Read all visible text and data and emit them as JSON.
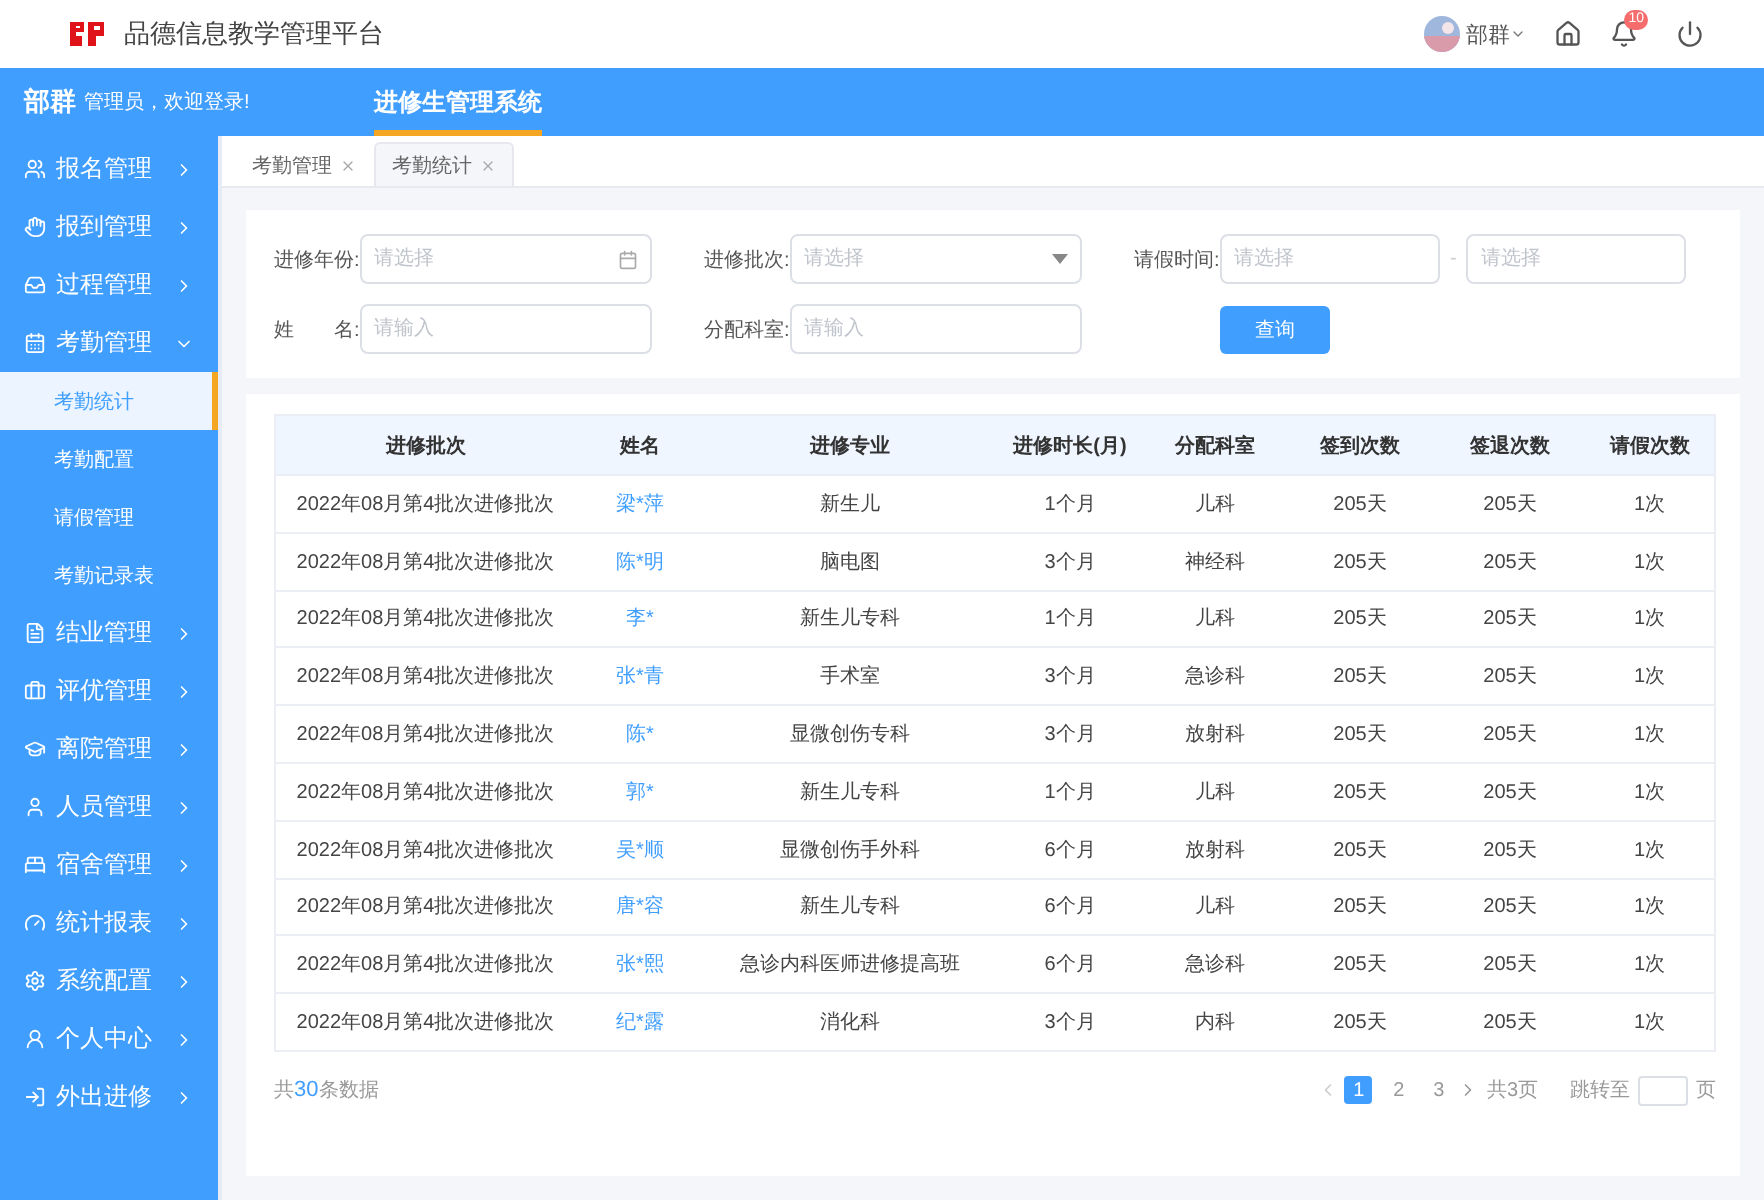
{
  "header": {
    "title": "品德信息教学管理平台",
    "user": "部群",
    "notification_count": "10"
  },
  "topbar": {
    "user": "部群",
    "greeting": "管理员，欢迎登录!",
    "system_tabs": [
      {
        "label": "进修生管理系统",
        "selected": true
      }
    ]
  },
  "sidebar": {
    "items": [
      {
        "label": "报名管理",
        "expanded": false
      },
      {
        "label": "报到管理",
        "expanded": false
      },
      {
        "label": "过程管理",
        "expanded": false
      },
      {
        "label": "考勤管理",
        "expanded": true,
        "children": [
          {
            "label": "考勤统计",
            "selected": true
          },
          {
            "label": "考勤配置",
            "selected": false
          },
          {
            "label": "请假管理",
            "selected": false
          },
          {
            "label": "考勤记录表",
            "selected": false
          }
        ]
      },
      {
        "label": "结业管理",
        "expanded": false
      },
      {
        "label": "评优管理",
        "expanded": false
      },
      {
        "label": "离院管理",
        "expanded": false
      },
      {
        "label": "人员管理",
        "expanded": false
      },
      {
        "label": "宿舍管理",
        "expanded": false
      },
      {
        "label": "统计报表",
        "expanded": false
      },
      {
        "label": "系统配置",
        "expanded": false
      },
      {
        "label": "个人中心",
        "expanded": false
      },
      {
        "label": "外出进修",
        "expanded": false
      }
    ]
  },
  "tabs": [
    {
      "label": "考勤管理",
      "selected": false
    },
    {
      "label": "考勤统计",
      "selected": true
    }
  ],
  "filters": [
    {
      "label": "进修年份:",
      "placeholder": "请选择",
      "kind": "date"
    },
    {
      "label": "进修批次:",
      "placeholder": "请选择",
      "kind": "select"
    },
    {
      "label": "请假时间:",
      "kind": "range",
      "placeholder": "请选择",
      "separator": "-",
      "placeholder_end": "请选择"
    },
    {
      "label": "姓　　名:",
      "placeholder": "请输入",
      "kind": "text"
    },
    {
      "label": "分配科室:",
      "placeholder": "请输入",
      "kind": "text"
    }
  ],
  "query_button": "查询",
  "table": {
    "columns": [
      "进修批次",
      "姓名",
      "进修专业",
      "进修时长(月)",
      "分配科室",
      "签到次数",
      "签退次数",
      "请假次数"
    ],
    "rows": [
      [
        "2022年08月第4批次进修批次",
        "梁*萍",
        "新生儿",
        "1个月",
        "儿科",
        "205天",
        "205天",
        "1次"
      ],
      [
        "2022年08月第4批次进修批次",
        "陈*明",
        "脑电图",
        "3个月",
        "神经科",
        "205天",
        "205天",
        "1次"
      ],
      [
        "2022年08月第4批次进修批次",
        "李*",
        "新生儿专科",
        "1个月",
        "儿科",
        "205天",
        "205天",
        "1次"
      ],
      [
        "2022年08月第4批次进修批次",
        "张*青",
        "手术室",
        "3个月",
        "急诊科",
        "205天",
        "205天",
        "1次"
      ],
      [
        "2022年08月第4批次进修批次",
        "陈*",
        "显微创伤专科",
        "3个月",
        "放射科",
        "205天",
        "205天",
        "1次"
      ],
      [
        "2022年08月第4批次进修批次",
        "郭*",
        "新生儿专科",
        "1个月",
        "儿科",
        "205天",
        "205天",
        "1次"
      ],
      [
        "2022年08月第4批次进修批次",
        "吴*顺",
        "显微创伤手外科",
        "6个月",
        "放射科",
        "205天",
        "205天",
        "1次"
      ],
      [
        "2022年08月第4批次进修批次",
        "唐*容",
        "新生儿专科",
        "6个月",
        "儿科",
        "205天",
        "205天",
        "1次"
      ],
      [
        "2022年08月第4批次进修批次",
        "张*熙",
        "急诊内科医师进修提高班",
        "6个月",
        "急诊科",
        "205天",
        "205天",
        "1次"
      ],
      [
        "2022年08月第4批次进修批次",
        "纪*露",
        "消化科",
        "3个月",
        "内科",
        "205天",
        "205天",
        "1次"
      ]
    ]
  },
  "pagination": {
    "total": "共**30**条数据",
    "pages": [
      {
        "label": "1",
        "selected": true
      },
      {
        "label": "2",
        "selected": false
      },
      {
        "label": "3",
        "selected": false
      }
    ],
    "page_count": "共3页",
    "jump_label": "跳转至",
    "jump_suffix": "页"
  }
}
